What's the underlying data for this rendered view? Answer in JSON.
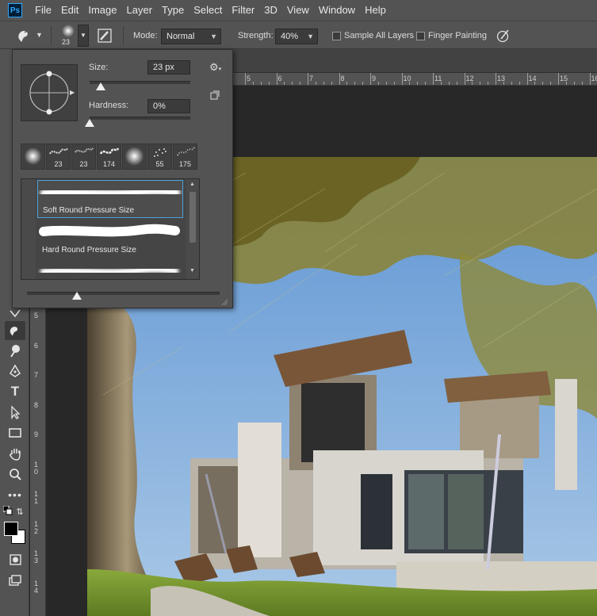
{
  "app": {
    "logo": "Ps"
  },
  "menu": [
    "File",
    "Edit",
    "Image",
    "Layer",
    "Type",
    "Select",
    "Filter",
    "3D",
    "View",
    "Window",
    "Help"
  ],
  "options": {
    "brush_size": "23",
    "mode_label": "Mode:",
    "mode_value": "Normal",
    "strength_label": "Strength:",
    "strength_value": "40%",
    "sample_all_layers": "Sample All Layers",
    "finger_painting": "Finger Painting"
  },
  "brush_popup": {
    "size_label": "Size:",
    "size_value": "23 px",
    "hardness_label": "Hardness:",
    "hardness_value": "0%",
    "presets": [
      "",
      "23",
      "23",
      "174",
      "",
      "55",
      "175"
    ],
    "brushes": [
      "Soft Round Pressure Size",
      "Hard Round Pressure Size",
      ""
    ]
  },
  "ruler": {
    "h_numbers": [
      "5",
      "6",
      "7",
      "8",
      "9",
      "10",
      "11",
      "12",
      "13",
      "14",
      "15",
      "16"
    ],
    "v_numbers": [
      "5",
      "6",
      "7",
      "8",
      "9",
      "10",
      "11",
      "12",
      "13",
      "14"
    ]
  },
  "colors": {
    "accent": "#4ba3d8",
    "panel": "#535353",
    "ps_blue": "#31a8ff"
  }
}
